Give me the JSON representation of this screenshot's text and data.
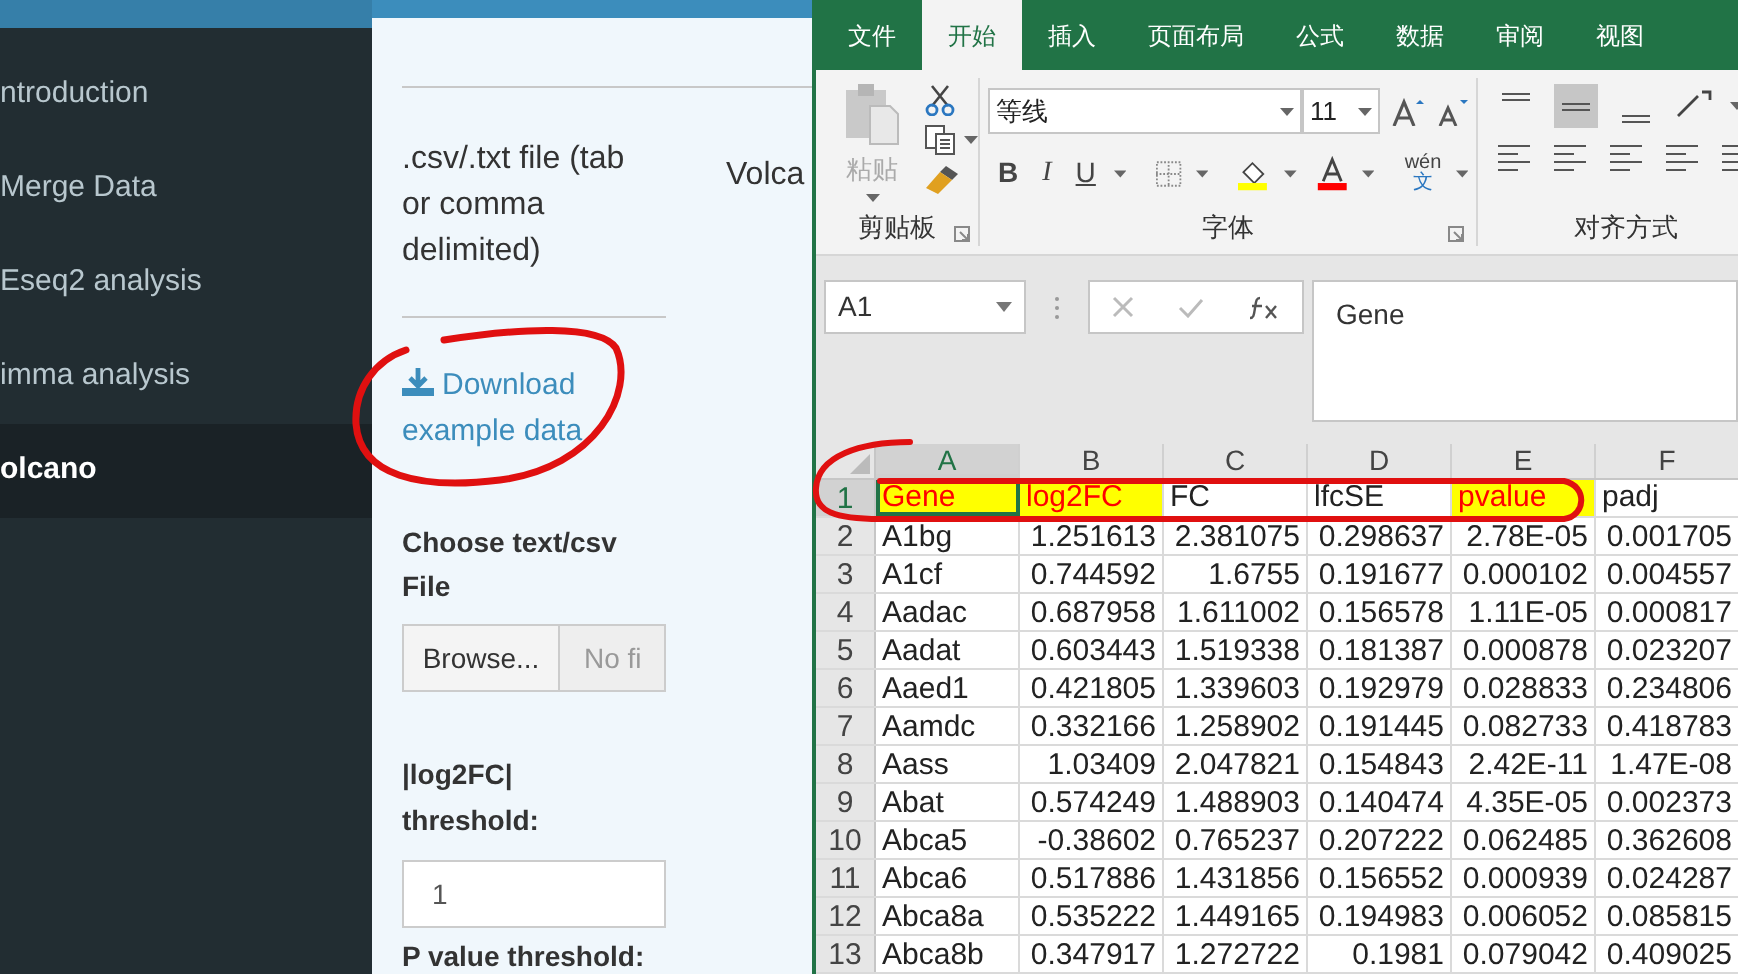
{
  "sidebar": {
    "items": [
      {
        "label": "ntroduction",
        "selected": false
      },
      {
        "label": "Merge Data",
        "selected": false
      },
      {
        "label": "Eseq2 analysis",
        "selected": false
      },
      {
        "label": "imma analysis",
        "selected": false
      },
      {
        "label": "olcano",
        "selected": true
      }
    ]
  },
  "panel": {
    "file_note": ".csv/.txt file (tab or comma delimited)",
    "side_title": "Volca",
    "download_link": "Download example data",
    "file_label": "Choose text/csv File",
    "browse_button": "Browse...",
    "file_status": "No fi",
    "log2fc_label": "|log2FC| threshold:",
    "log2fc_value": "1",
    "pvalue_label": "P value threshold:"
  },
  "excel": {
    "tabs": [
      {
        "label": "文件",
        "selected": false
      },
      {
        "label": "开始",
        "selected": true
      },
      {
        "label": "插入",
        "selected": false
      },
      {
        "label": "页面布局",
        "selected": false
      },
      {
        "label": "公式",
        "selected": false
      },
      {
        "label": "数据",
        "selected": false
      },
      {
        "label": "审阅",
        "selected": false
      },
      {
        "label": "视图",
        "selected": false
      }
    ],
    "ribbon": {
      "paste": "粘贴",
      "clipboard_group": "剪贴板",
      "font_name": "等线",
      "font_size": "11",
      "bold": "B",
      "italic": "I",
      "underline": "U",
      "phonetic": "wén",
      "phonetic_char": "文",
      "font_group": "字体",
      "alignment_group": "对齐方式"
    },
    "name_box": "A1",
    "formula": "Gene",
    "columns": [
      {
        "label": "A",
        "selected": true
      },
      {
        "label": "B",
        "selected": false
      },
      {
        "label": "C",
        "selected": false
      },
      {
        "label": "D",
        "selected": false
      },
      {
        "label": "E",
        "selected": false
      },
      {
        "label": "F",
        "selected": false
      }
    ],
    "rows": [
      {
        "number": "1",
        "selected": true,
        "kind": "header",
        "cells": [
          {
            "text": "Gene",
            "highlight": true,
            "selected": true
          },
          {
            "text": "log2FC",
            "highlight": true,
            "selected": false
          },
          {
            "text": "FC",
            "highlight": false,
            "selected": false
          },
          {
            "text": "lfcSE",
            "highlight": false,
            "selected": false
          },
          {
            "text": "pvalue",
            "highlight": true,
            "selected": false
          },
          {
            "text": "padj",
            "highlight": false,
            "selected": false
          }
        ]
      },
      {
        "number": "2",
        "selected": false,
        "kind": "data",
        "values": [
          "A1bg",
          "1.251613",
          "2.381075",
          "0.298637",
          "2.78E-05",
          "0.001705"
        ]
      },
      {
        "number": "3",
        "selected": false,
        "kind": "data",
        "values": [
          "A1cf",
          "0.744592",
          "1.6755",
          "0.191677",
          "0.000102",
          "0.004557"
        ]
      },
      {
        "number": "4",
        "selected": false,
        "kind": "data",
        "values": [
          "Aadac",
          "0.687958",
          "1.611002",
          "0.156578",
          "1.11E-05",
          "0.000817"
        ]
      },
      {
        "number": "5",
        "selected": false,
        "kind": "data",
        "values": [
          "Aadat",
          "0.603443",
          "1.519338",
          "0.181387",
          "0.000878",
          "0.023207"
        ]
      },
      {
        "number": "6",
        "selected": false,
        "kind": "data",
        "values": [
          "Aaed1",
          "0.421805",
          "1.339603",
          "0.192979",
          "0.028833",
          "0.234806"
        ]
      },
      {
        "number": "7",
        "selected": false,
        "kind": "data",
        "values": [
          "Aamdc",
          "0.332166",
          "1.258902",
          "0.191445",
          "0.082733",
          "0.418783"
        ]
      },
      {
        "number": "8",
        "selected": false,
        "kind": "data",
        "values": [
          "Aass",
          "1.03409",
          "2.047821",
          "0.154843",
          "2.42E-11",
          "1.47E-08"
        ]
      },
      {
        "number": "9",
        "selected": false,
        "kind": "data",
        "values": [
          "Abat",
          "0.574249",
          "1.488903",
          "0.140474",
          "4.35E-05",
          "0.002373"
        ]
      },
      {
        "number": "10",
        "selected": false,
        "kind": "data",
        "values": [
          "Abca5",
          "-0.38602",
          "0.765237",
          "0.207222",
          "0.062485",
          "0.362608"
        ]
      },
      {
        "number": "11",
        "selected": false,
        "kind": "data",
        "values": [
          "Abca6",
          "0.517886",
          "1.431856",
          "0.156552",
          "0.000939",
          "0.024287"
        ]
      },
      {
        "number": "12",
        "selected": false,
        "kind": "data",
        "values": [
          "Abca8a",
          "0.535222",
          "1.449165",
          "0.194983",
          "0.006052",
          "0.085815"
        ]
      },
      {
        "number": "13",
        "selected": false,
        "kind": "data",
        "values": [
          "Abca8b",
          "0.347917",
          "1.272722",
          "0.1981",
          "0.079042",
          "0.409025"
        ]
      }
    ]
  }
}
